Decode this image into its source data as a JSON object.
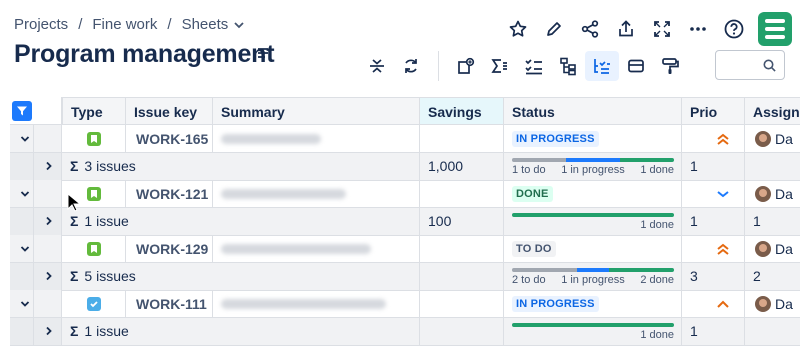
{
  "breadcrumb": {
    "items": [
      "Projects",
      "Fine work",
      "Sheets"
    ],
    "separator": "/"
  },
  "page": {
    "title": "Program management"
  },
  "top_actions": [
    "star-icon",
    "edit-icon",
    "share-icon",
    "export-icon",
    "fullscreen-icon",
    "more-icon",
    "help-icon"
  ],
  "toolbar": [
    "collapse-rows-icon",
    "refresh-icon",
    "add-structure-icon",
    "sum-icon",
    "checklist-icon",
    "hierarchy-icon",
    "group-icon",
    "card-view-icon",
    "format-painter-icon"
  ],
  "search": {
    "placeholder": ""
  },
  "colors": {
    "accent": "#1d7afc",
    "in_progress": "#1d7afc",
    "done": "#22a06b",
    "todo": "#a1a7b0",
    "priority_high": "#e56910",
    "priority_low": "#1d7afc"
  },
  "columns": [
    "Type",
    "Issue key",
    "Summary",
    "Savings",
    "Status",
    "Prio",
    "Assignee"
  ],
  "rows": [
    {
      "kind": "main",
      "type": "story",
      "key": "WORK-165",
      "status": "IN PROGRESS",
      "status_style": "progress",
      "prio": "highest",
      "assignee": "Da"
    },
    {
      "kind": "sub",
      "label": "3 issues",
      "savings": "1,000",
      "progress": {
        "todo": 1,
        "in_progress": 1,
        "done": 1
      },
      "labels": [
        "1 to do",
        "1 in progress",
        "1 done"
      ],
      "prio": "1",
      "assignee": ""
    },
    {
      "kind": "main",
      "type": "story",
      "key": "WORK-121",
      "status": "DONE",
      "status_style": "done",
      "prio": "low",
      "assignee": "Da"
    },
    {
      "kind": "sub",
      "label": "1 issue",
      "savings": "100",
      "progress": {
        "todo": 0,
        "in_progress": 0,
        "done": 1
      },
      "labels": [
        "",
        "",
        "1 done"
      ],
      "prio": "1",
      "assignee": "1"
    },
    {
      "kind": "main",
      "type": "story",
      "key": "WORK-129",
      "status": "TO DO",
      "status_style": "todo",
      "prio": "highest",
      "assignee": "Da"
    },
    {
      "kind": "sub",
      "label": "5 issues",
      "savings": "",
      "progress": {
        "todo": 2,
        "in_progress": 1,
        "done": 2
      },
      "labels": [
        "2 to do",
        "1 in progress",
        "2 done"
      ],
      "prio": "3",
      "assignee": "2"
    },
    {
      "kind": "main",
      "type": "task",
      "key": "WORK-111",
      "status": "IN PROGRESS",
      "status_style": "progress",
      "prio": "high",
      "assignee": "Da"
    },
    {
      "kind": "sub",
      "label": "1 issue",
      "savings": "",
      "progress": {
        "todo": 0,
        "in_progress": 0,
        "done": 1
      },
      "labels": [
        "",
        "",
        "1 done"
      ],
      "prio": "1",
      "assignee": ""
    }
  ]
}
